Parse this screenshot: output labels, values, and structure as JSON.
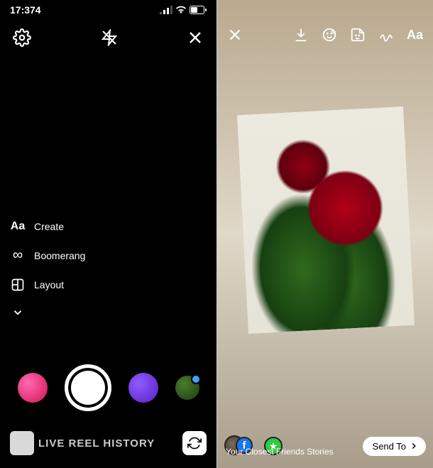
{
  "status": {
    "time": "17:374",
    "signal": "•ıl",
    "wifi": true,
    "battery": 50
  },
  "camera": {
    "modes": [
      {
        "icon": "Aa",
        "label": "Create"
      },
      {
        "icon": "∞",
        "label": "Boomerang"
      },
      {
        "icon": "layout",
        "label": "Layout"
      }
    ],
    "tabs": "LIVE REEL HISTORY",
    "filters": [
      {
        "name": "pink-sparkle"
      },
      {
        "name": "purple-glow"
      },
      {
        "name": "green-mask"
      }
    ]
  },
  "editor": {
    "toolbar_text_label": "Aa",
    "photo_subject": "red roses with green leaves",
    "share": {
      "row_label": "Your Closest Friends Stories",
      "send_label": "Send To"
    }
  }
}
